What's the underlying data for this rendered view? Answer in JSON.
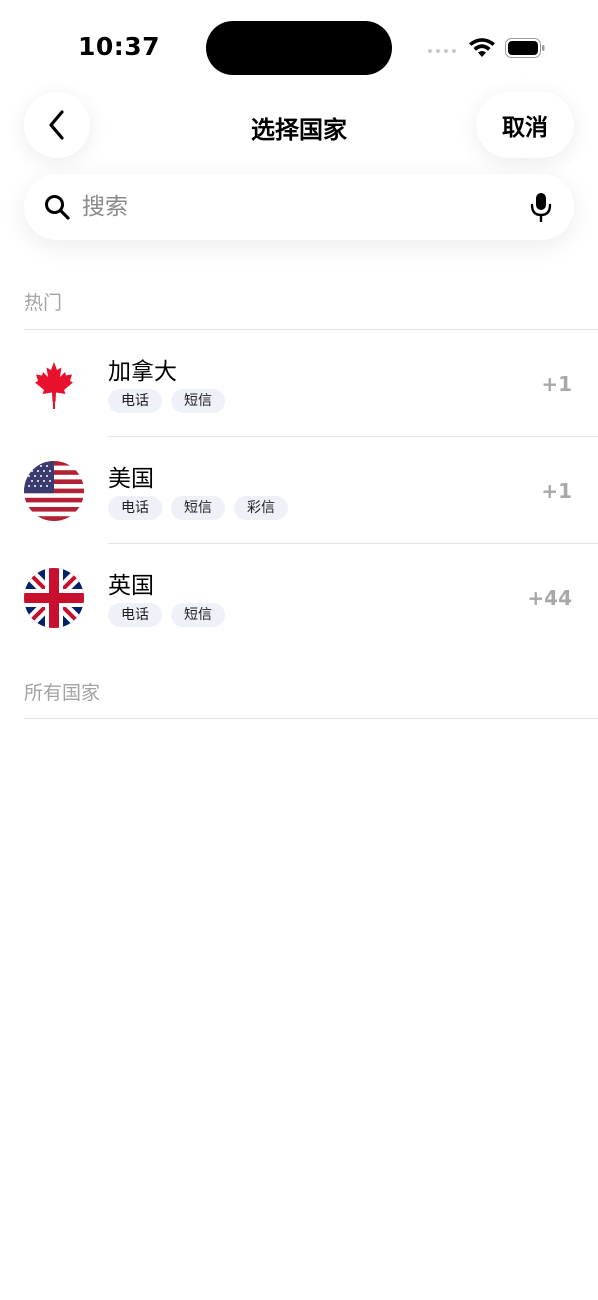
{
  "status_bar": {
    "time": "10:37"
  },
  "header": {
    "title": "选择国家",
    "cancel_label": "取消"
  },
  "search": {
    "placeholder": "搜索"
  },
  "sections": {
    "popular": "热门",
    "all": "所有国家"
  },
  "countries": [
    {
      "name": "加拿大",
      "code": "+1",
      "flag": "canada-flag-icon",
      "tags": [
        "电话",
        "短信"
      ]
    },
    {
      "name": "美国",
      "code": "+1",
      "flag": "us-flag-icon",
      "tags": [
        "电话",
        "短信",
        "彩信"
      ]
    },
    {
      "name": "英国",
      "code": "+44",
      "flag": "uk-flag-icon",
      "tags": [
        "电话",
        "短信"
      ]
    }
  ],
  "colors": {
    "tag_bg": "#eef1f8",
    "code_text": "#a8a8a8",
    "section_text": "#a3a3a3",
    "canada_red": "#e8112d",
    "us_blue": "#3c3b6e",
    "us_red": "#b22234",
    "uk_blue": "#012169",
    "uk_red": "#c8102e"
  }
}
